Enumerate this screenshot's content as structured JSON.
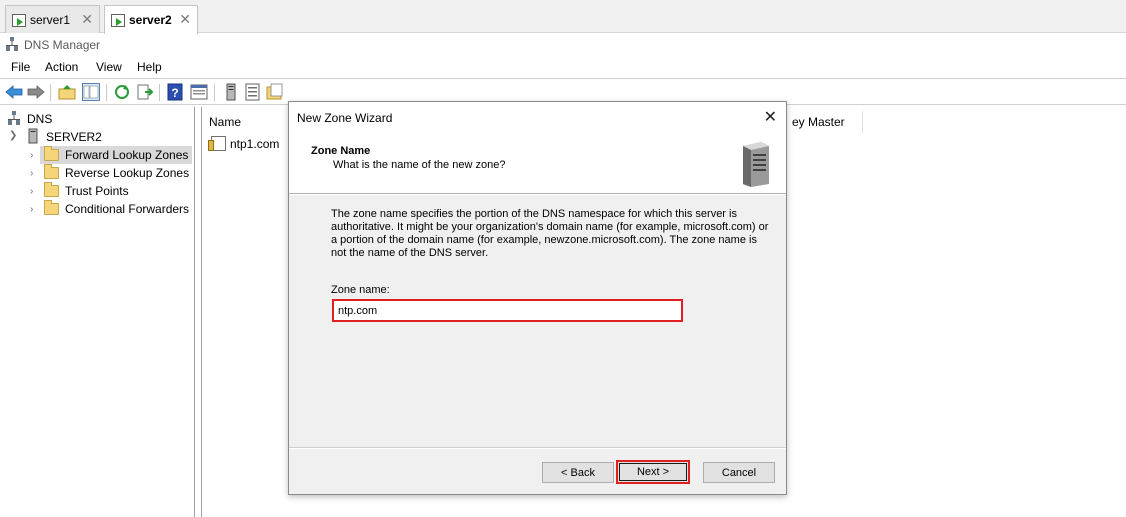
{
  "tabs": [
    {
      "label": "server1",
      "active": false
    },
    {
      "label": "server2",
      "active": true
    }
  ],
  "app": {
    "title": "DNS Manager"
  },
  "menu": [
    "File",
    "Action",
    "View",
    "Help"
  ],
  "tree": {
    "root": "DNS",
    "server": "SERVER2",
    "children": [
      "Forward Lookup Zones",
      "Reverse Lookup Zones",
      "Trust Points",
      "Conditional Forwarders"
    ],
    "selected": "Forward Lookup Zones"
  },
  "list": {
    "columns": [
      "Name",
      "ey Master"
    ],
    "rows": [
      "ntp1.com"
    ]
  },
  "dialog": {
    "title": "New Zone Wizard",
    "close_glyph": "✕",
    "heading": "Zone Name",
    "subheading": "What is the name of the new zone?",
    "description": "The zone name specifies the portion of the DNS namespace for which this server is authoritative. It might be your organization's domain name (for example,  microsoft.com) or a portion of the domain name (for example, newzone.microsoft.com). The zone name is not the name of the DNS server.",
    "zone_label": "Zone name:",
    "zone_value": "ntp.com",
    "back_label": "< Back",
    "next_label": "Next >",
    "cancel_label": "Cancel"
  },
  "colors": {
    "highlight": "#e02020",
    "folder": "#f4d57a",
    "body_bg": "#f0f0f0"
  },
  "icons": [
    "back-arrow-icon",
    "forward-arrow-icon",
    "up-folder-icon",
    "show-hide-tree-icon",
    "refresh-icon",
    "export-list-icon",
    "help-icon",
    "properties-icon",
    "server-icon",
    "list-icon",
    "folder-icon"
  ]
}
